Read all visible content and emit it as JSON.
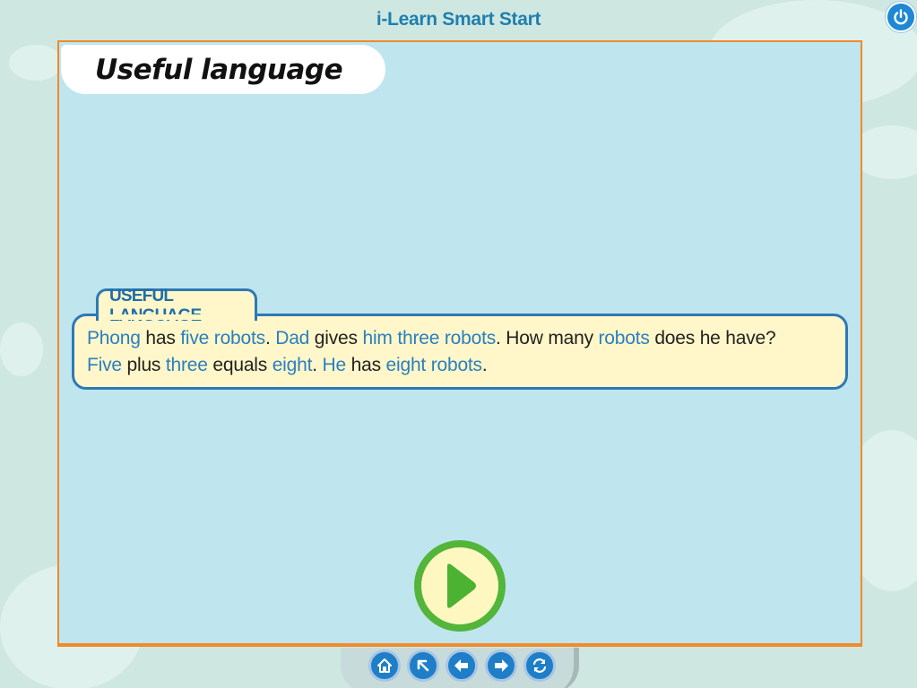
{
  "app": {
    "title": "i-Learn Smart Start"
  },
  "slide": {
    "heading": "Useful language"
  },
  "useful_language": {
    "tab_label": "USEFUL LANGUAGE",
    "line1": [
      {
        "text": "Phong",
        "color": "blue"
      },
      {
        "text": " has ",
        "color": "black"
      },
      {
        "text": "five robots",
        "color": "blue"
      },
      {
        "text": ". ",
        "color": "black"
      },
      {
        "text": "Dad",
        "color": "blue"
      },
      {
        "text": " gives ",
        "color": "black"
      },
      {
        "text": "him three robots",
        "color": "blue"
      },
      {
        "text": ". How many ",
        "color": "black"
      },
      {
        "text": "robots",
        "color": "blue"
      },
      {
        "text": " does he have?",
        "color": "black"
      }
    ],
    "line2": [
      {
        "text": "Five",
        "color": "blue"
      },
      {
        "text": " plus ",
        "color": "black"
      },
      {
        "text": "three",
        "color": "blue"
      },
      {
        "text": " equals ",
        "color": "black"
      },
      {
        "text": "eight",
        "color": "blue"
      },
      {
        "text": ". ",
        "color": "black"
      },
      {
        "text": "He",
        "color": "blue"
      },
      {
        "text": " has ",
        "color": "black"
      },
      {
        "text": "eight robots",
        "color": "blue"
      },
      {
        "text": ".",
        "color": "black"
      }
    ]
  },
  "controls": {
    "play": "play-icon",
    "power": "power-icon",
    "nav": [
      "home-icon",
      "menu-arrow-icon",
      "back-icon",
      "next-icon",
      "replay-icon"
    ]
  },
  "colors": {
    "blue_text": "#2a7fc0",
    "frame_border": "#f08a2a",
    "stage_bg": "#bfe5ee",
    "play_green": "#53b53a"
  }
}
